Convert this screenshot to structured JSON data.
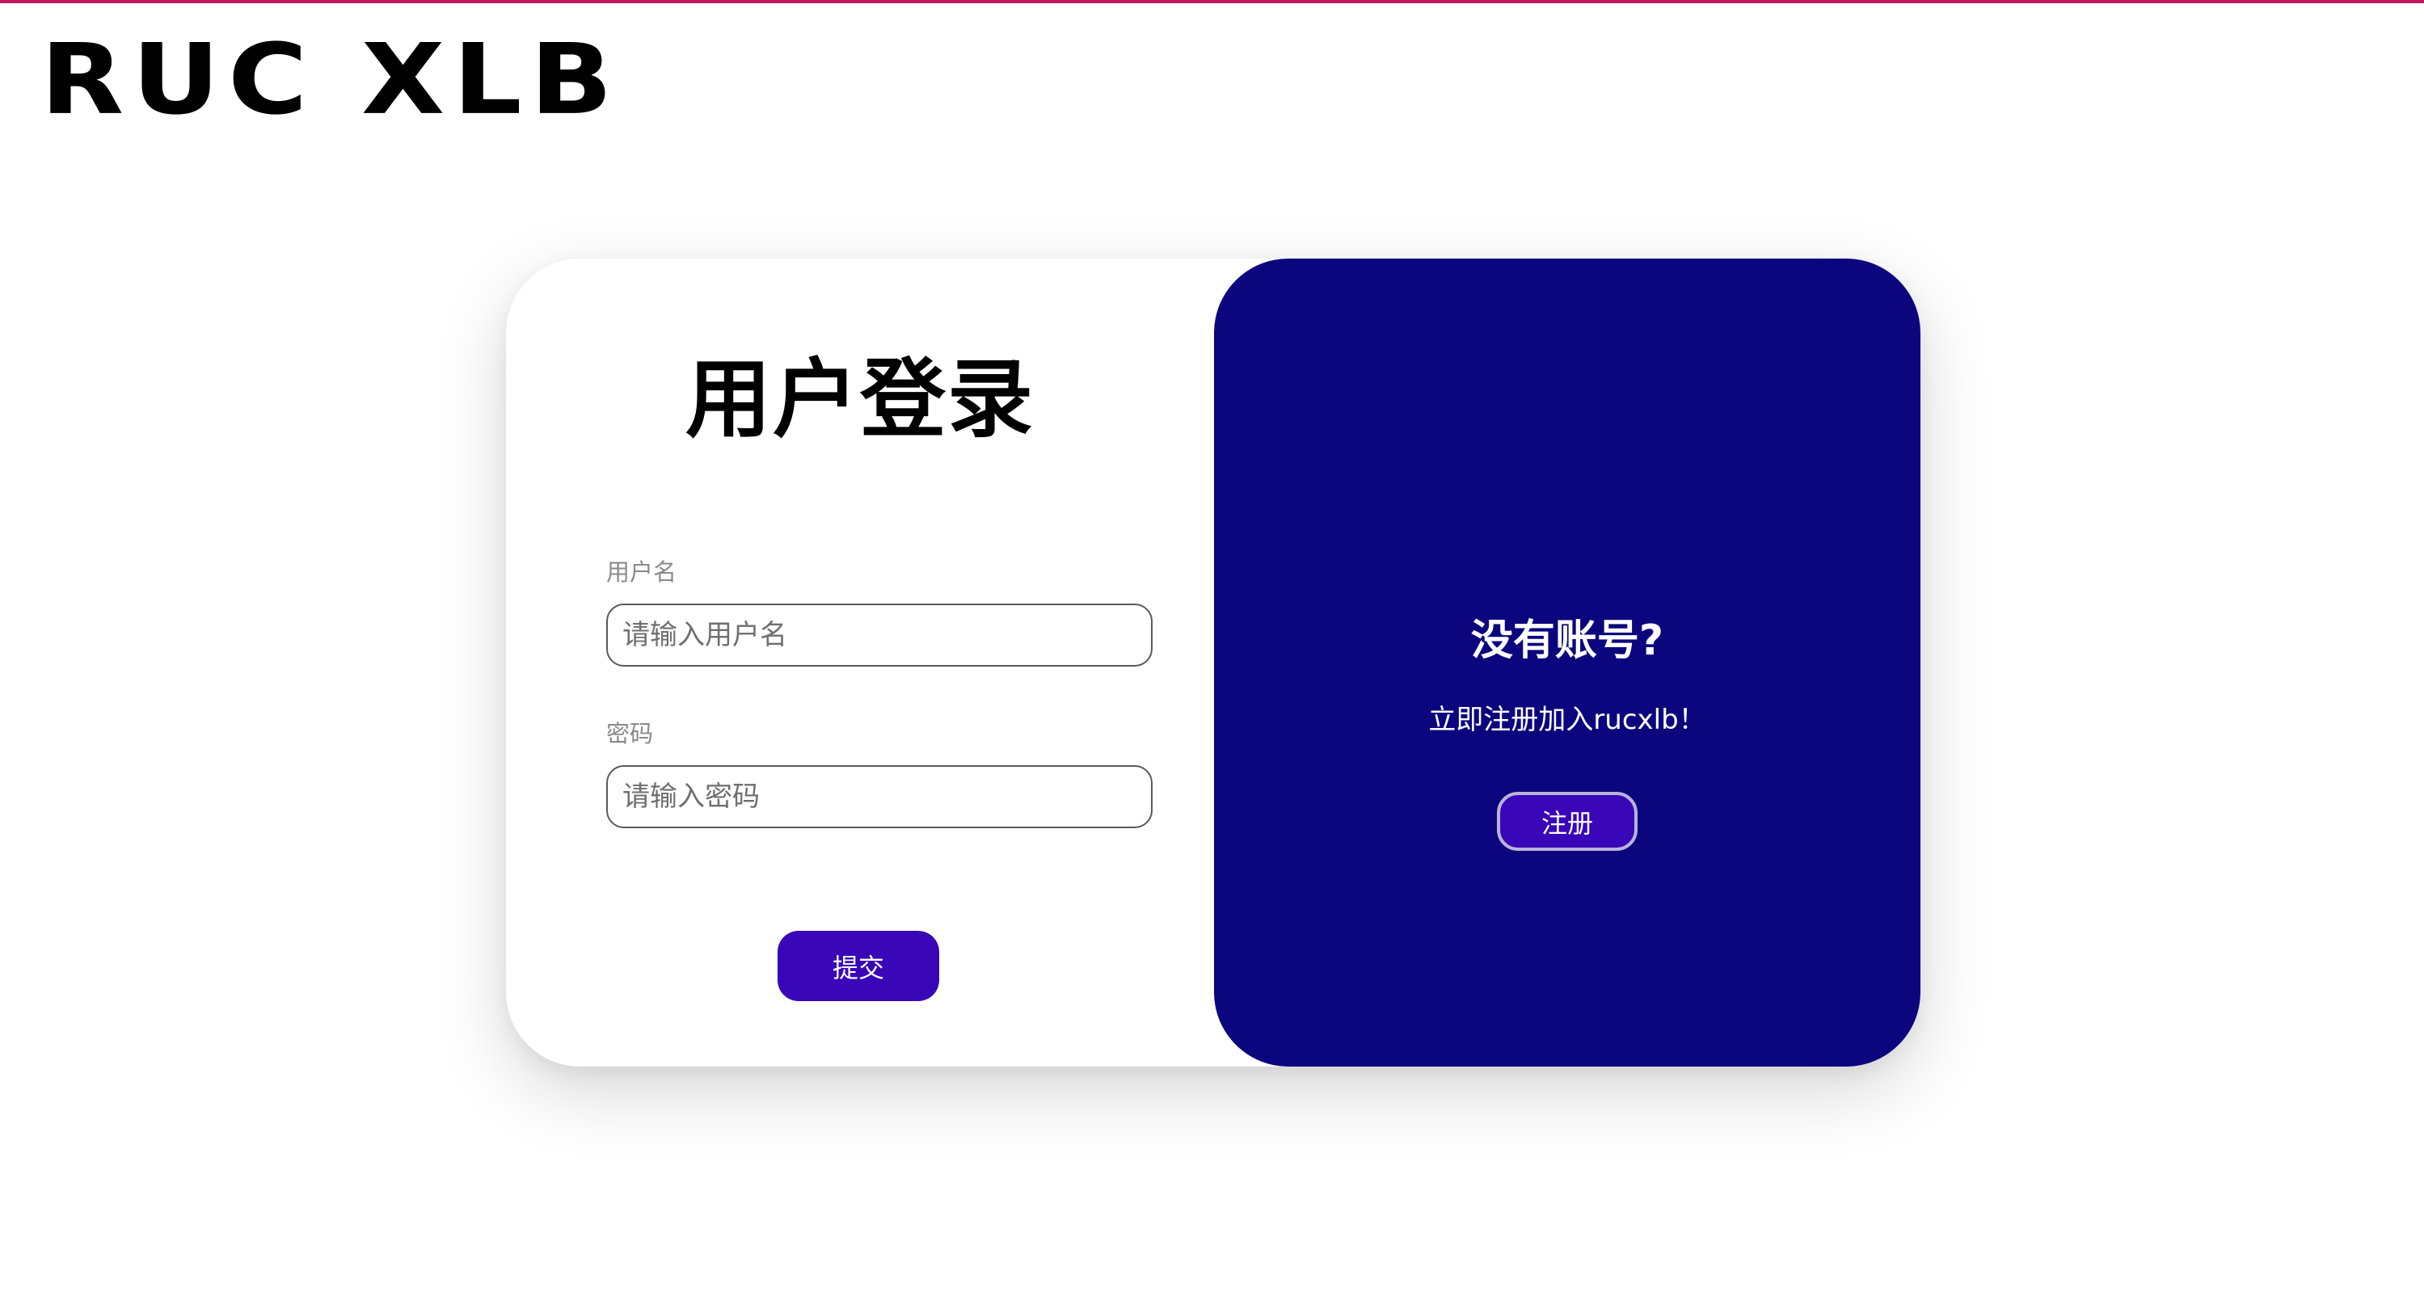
{
  "brand": {
    "logo_text": "RUC XLB"
  },
  "login": {
    "title": "用户登录",
    "username": {
      "label": "用户名",
      "placeholder": "请输入用户名",
      "value": ""
    },
    "password": {
      "label": "密码",
      "placeholder": "请输入密码",
      "value": ""
    },
    "submit_label": "提交"
  },
  "register": {
    "title": "没有账号?",
    "subtitle": "立即注册加入rucxlb！",
    "button_label": "注册"
  },
  "colors": {
    "accent_line": "#c2185b",
    "panel": "#0c067e",
    "button": "#3a07b8",
    "register_button_border": "#b9b3dc"
  }
}
